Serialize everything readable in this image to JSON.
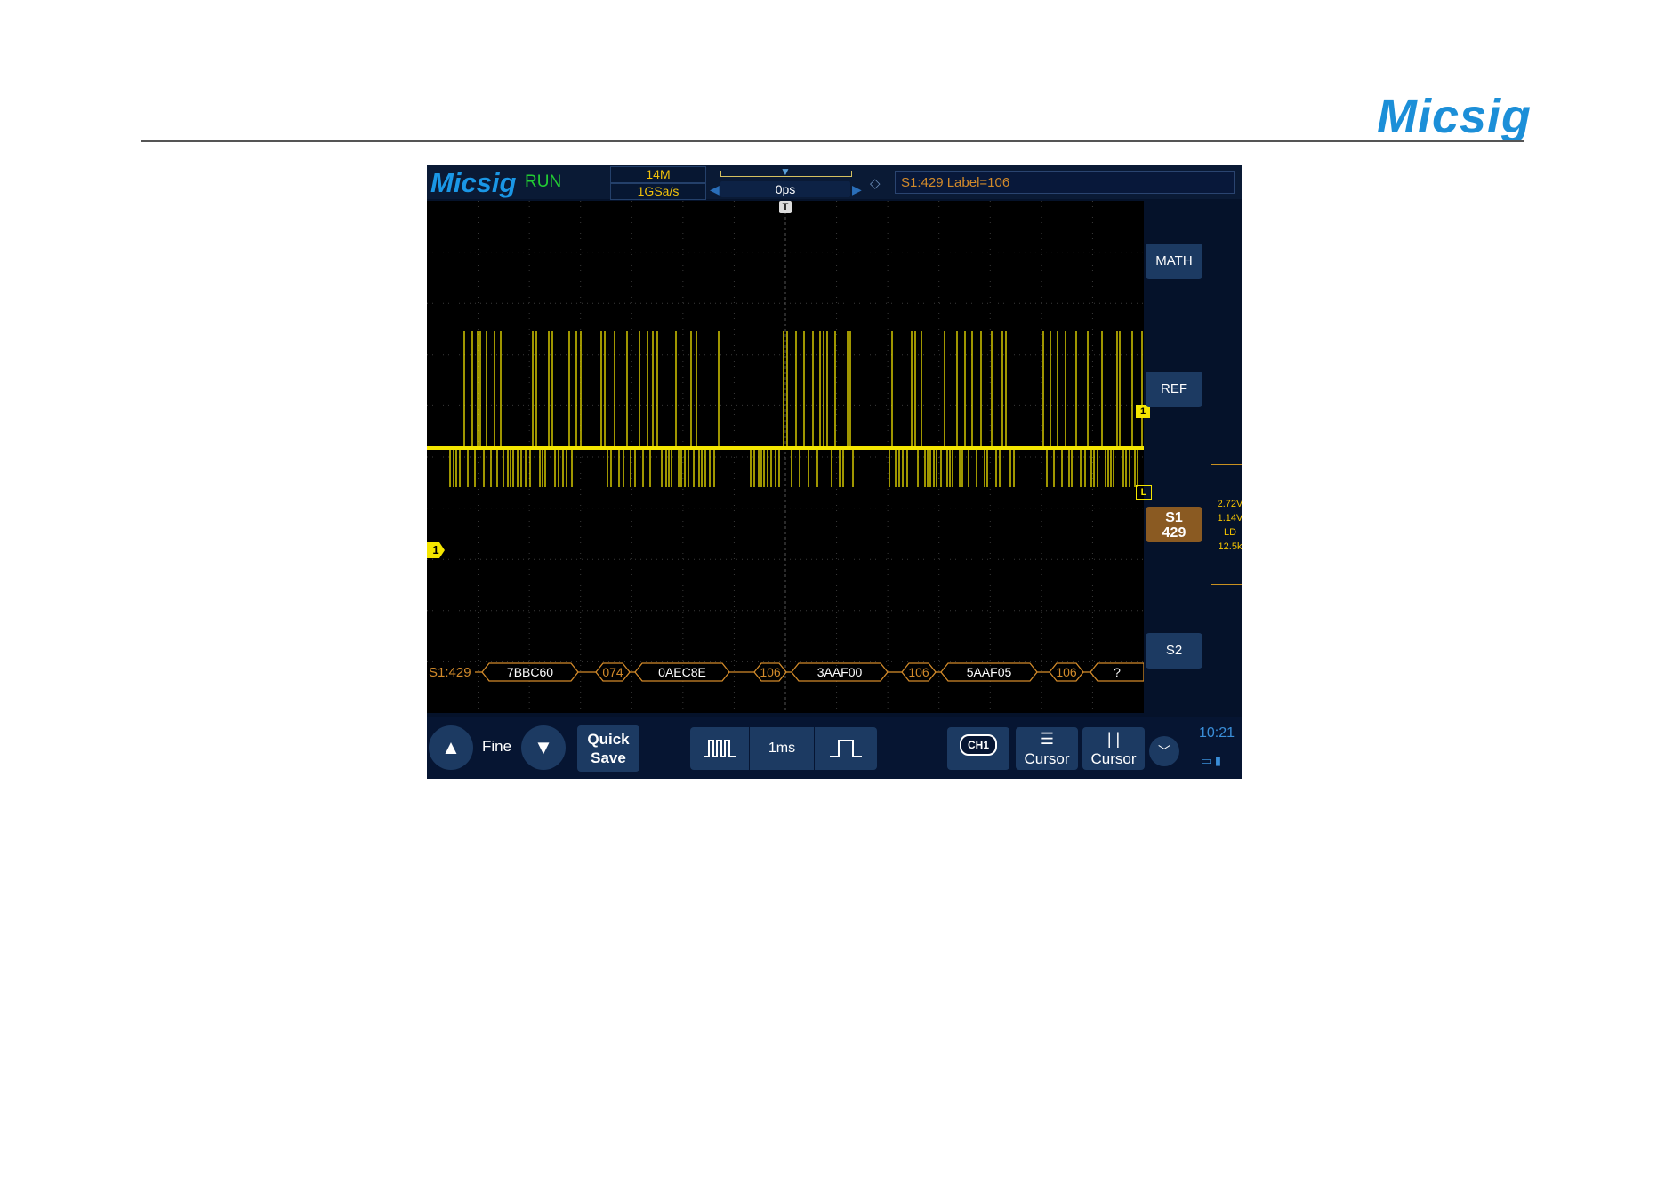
{
  "header": {
    "brand": "Micsig"
  },
  "scope": {
    "logo": "Micsig",
    "status": "RUN",
    "memory_depth": "14M",
    "sample_rate": "1GSa/s",
    "time_offset": "0ps",
    "trigger_info": "S1:429 Label=106",
    "trigger_marker": "T",
    "ch1_marker": "1",
    "level_marker_1": "1",
    "level_marker_L": "L",
    "colors": {
      "trace": "#f5e600",
      "decode": "#d28a2a",
      "accent": "#1c8fd8",
      "button": "#1c3a62",
      "run": "#22cc33"
    }
  },
  "decode": {
    "prefix": "S1:429",
    "frames": [
      "7BBC60",
      "074",
      "0AEC8E",
      "106",
      "3AAF00",
      "106",
      "5AAF05",
      "106",
      "?"
    ]
  },
  "right_panel": {
    "math": "MATH",
    "ref": "REF",
    "s1_line1": "S1",
    "s1_line2": "429",
    "s2": "S2",
    "measurements": [
      "2.72V",
      "1.14V",
      "LD",
      "12.5k"
    ]
  },
  "bottom": {
    "up_icon": "triangle-up-icon",
    "fine": "Fine",
    "down_icon": "triangle-down-icon",
    "quick_save_line1": "Quick",
    "quick_save_line2": "Save",
    "timebase": "1ms",
    "ch1": "CH1",
    "cursor_h": "Cursor",
    "cursor_v": "Cursor",
    "time": "10:21"
  }
}
